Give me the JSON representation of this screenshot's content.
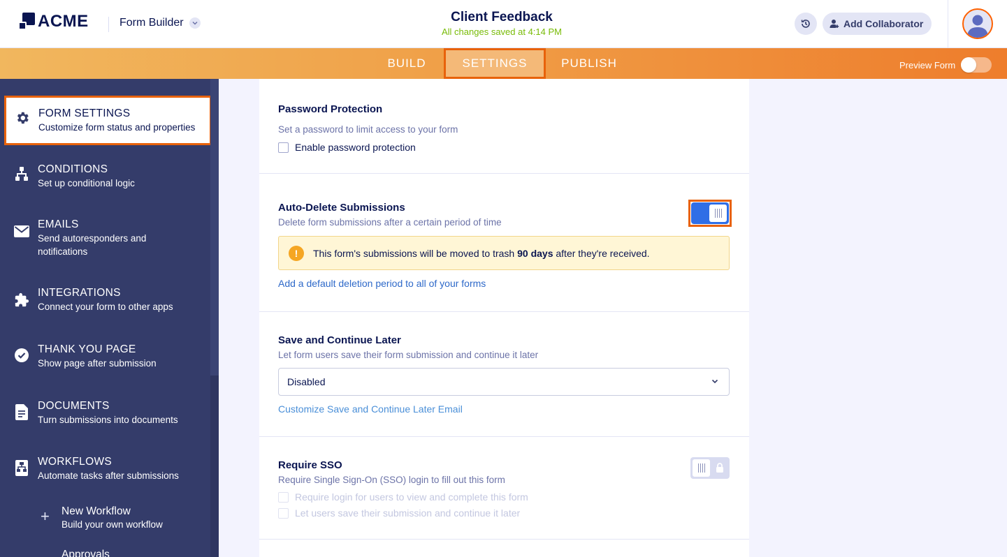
{
  "header": {
    "logo_text": "ACME",
    "builder_label": "Form Builder",
    "form_title": "Client Feedback",
    "save_status": "All changes saved at 4:14 PM",
    "collaborator_label": "Add Collaborator",
    "icons": {
      "history": "history-icon",
      "collaborator": "add-user-icon",
      "avatar": "user-avatar-icon"
    }
  },
  "nav": {
    "tabs": [
      {
        "label": "BUILD",
        "active": false
      },
      {
        "label": "SETTINGS",
        "active": true
      },
      {
        "label": "PUBLISH",
        "active": false
      }
    ],
    "preview_label": "Preview Form",
    "preview_on": false
  },
  "sidebar": {
    "items": [
      {
        "title": "FORM SETTINGS",
        "desc": "Customize form status and properties",
        "icon": "gear-icon",
        "active": true
      },
      {
        "title": "CONDITIONS",
        "desc": "Set up conditional logic",
        "icon": "conditions-icon"
      },
      {
        "title": "EMAILS",
        "desc": "Send autoresponders and notifications",
        "icon": "envelope-icon"
      },
      {
        "title": "INTEGRATIONS",
        "desc": "Connect your form to other apps",
        "icon": "puzzle-icon"
      },
      {
        "title": "THANK YOU PAGE",
        "desc": "Show page after submission",
        "icon": "check-circle-icon"
      },
      {
        "title": "DOCUMENTS",
        "desc": "Turn submissions into documents",
        "icon": "document-icon"
      },
      {
        "title": "WORKFLOWS",
        "desc": "Automate tasks after submissions",
        "icon": "workflow-icon"
      }
    ],
    "sub_items": [
      {
        "title": "New Workflow",
        "desc": "Build your own workflow",
        "icon": "plus-icon"
      },
      {
        "title": "Approvals",
        "desc": "",
        "icon": "approvals-icon"
      }
    ]
  },
  "settings": {
    "password": {
      "title": "Password Protection",
      "desc": "Set a password to limit access to your form",
      "checkbox_label": "Enable password protection",
      "checked": false
    },
    "auto_delete": {
      "title": "Auto-Delete Submissions",
      "desc": "Delete form submissions after a certain period of time",
      "enabled": true,
      "notice_before": "This form's submissions will be moved to trash ",
      "notice_bold": "90 days",
      "notice_after": " after they're received.",
      "link": "Add a default deletion period to all of your forms"
    },
    "save_continue": {
      "title": "Save and Continue Later",
      "desc": "Let form users save their form submission and continue it later",
      "select_value": "Disabled",
      "link": "Customize Save and Continue Later Email"
    },
    "sso": {
      "title": "Require SSO",
      "desc": "Require Single Sign-On (SSO) login to fill out this form",
      "locked": true,
      "options": [
        "Require login for users to view and complete this form",
        "Let users save their submission and continue it later"
      ]
    }
  },
  "colors": {
    "accent_orange": "#e8620b",
    "navy": "#0a1551",
    "sidebar_bg": "#343c6a",
    "toggle_blue": "#2f6ee6",
    "saved_green": "#78bb07"
  }
}
